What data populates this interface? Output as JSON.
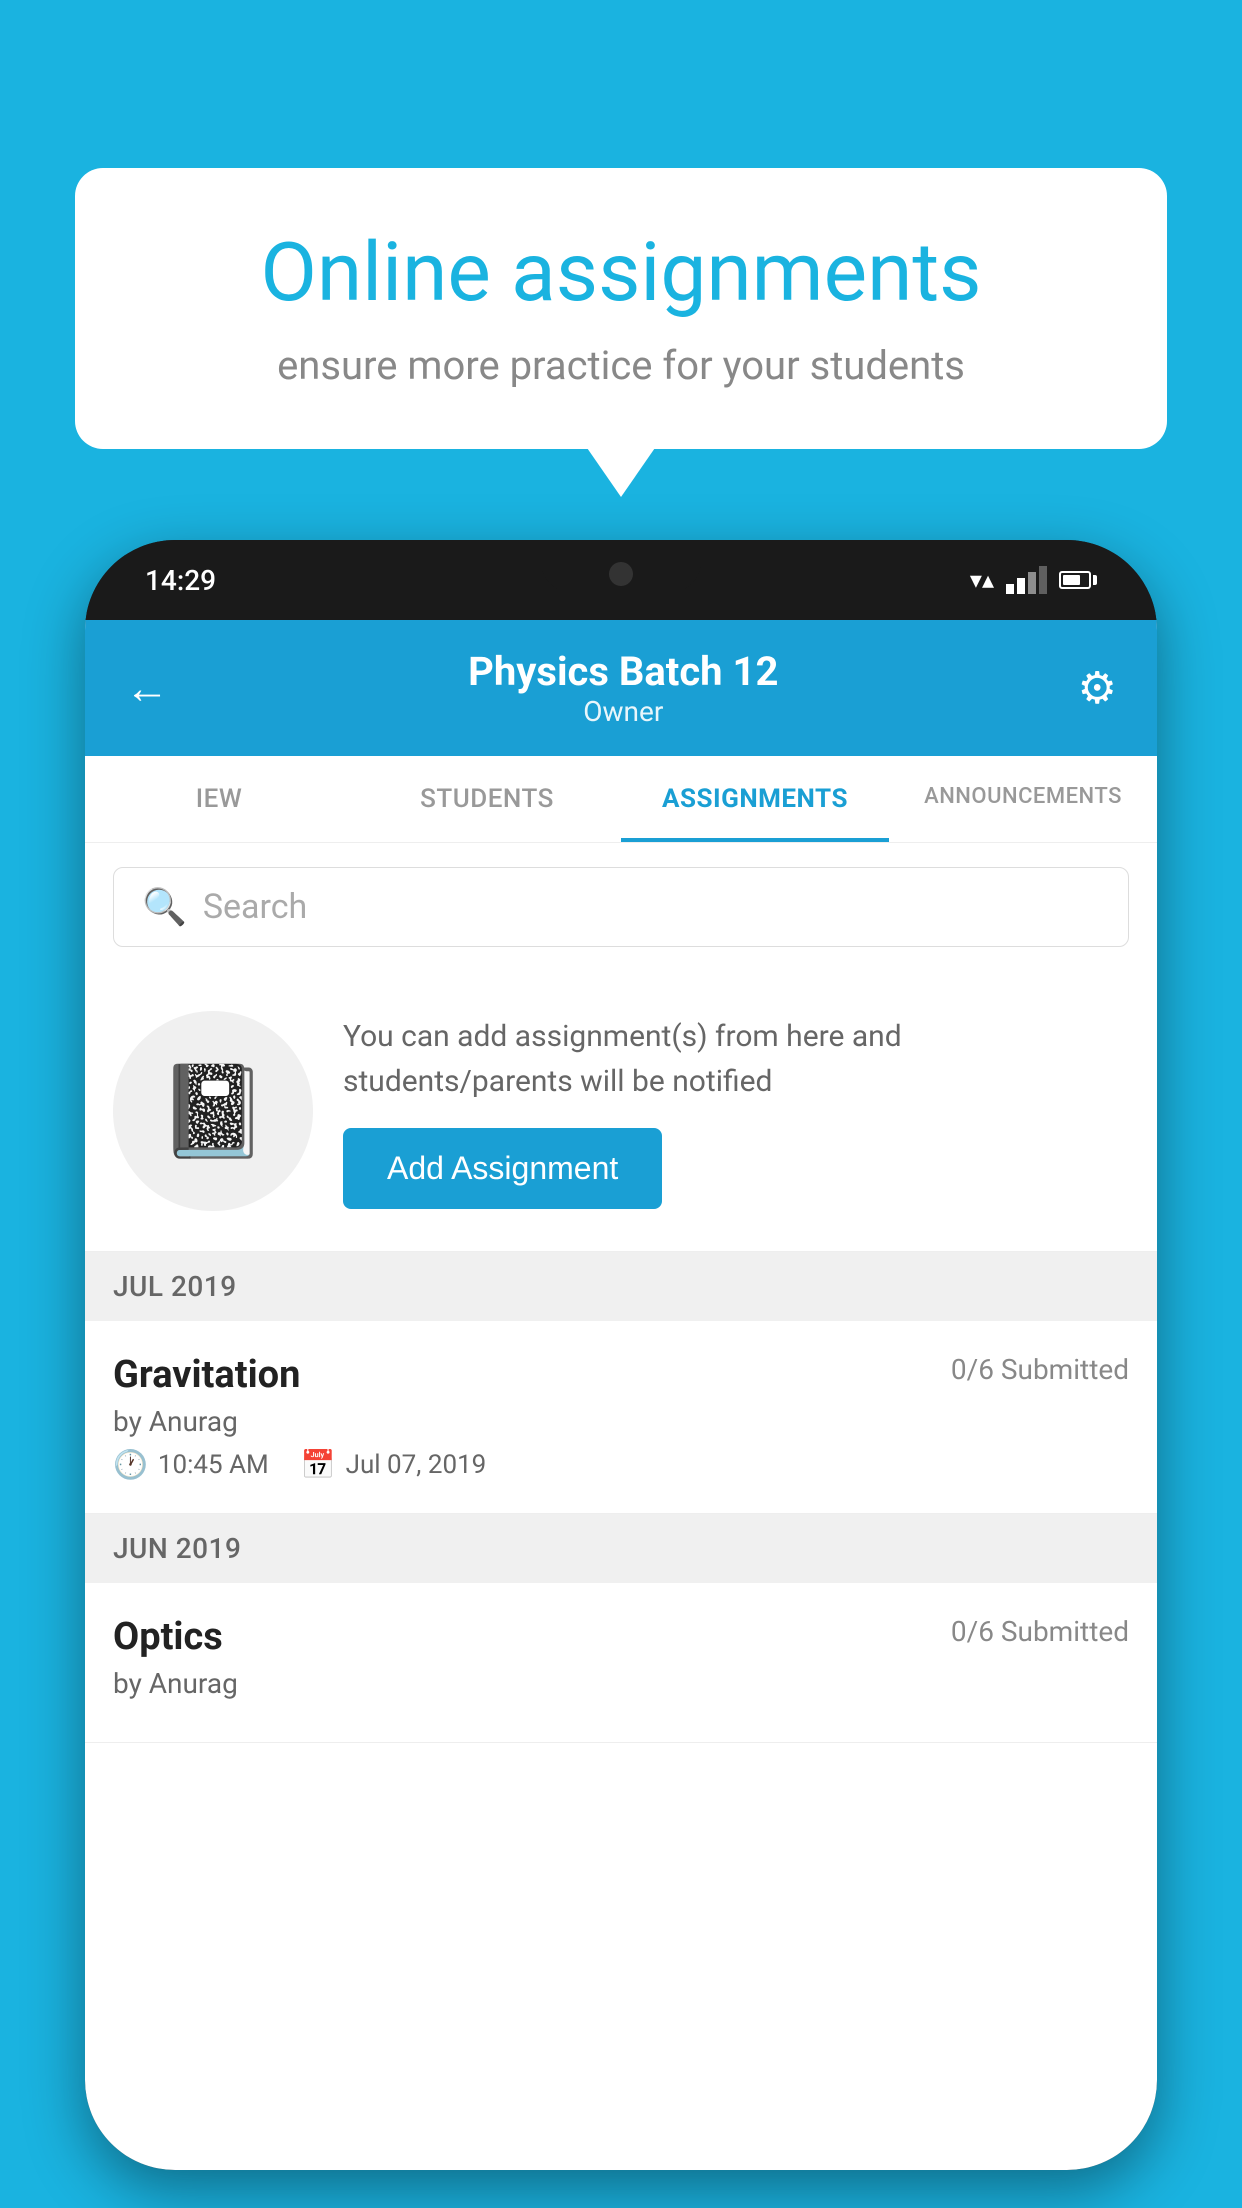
{
  "background_color": "#1ab3e0",
  "speech_bubble": {
    "title": "Online assignments",
    "subtitle": "ensure more practice for your students"
  },
  "phone": {
    "status_bar": {
      "time": "14:29",
      "wifi": "wifi",
      "signal": "signal",
      "battery": "battery"
    },
    "header": {
      "title": "Physics Batch 12",
      "subtitle": "Owner",
      "back_icon": "←",
      "settings_icon": "⚙"
    },
    "tabs": [
      {
        "label": "IEW",
        "active": false
      },
      {
        "label": "STUDENTS",
        "active": false
      },
      {
        "label": "ASSIGNMENTS",
        "active": true
      },
      {
        "label": "ANNOUNCEMENTS",
        "active": false
      }
    ],
    "search": {
      "placeholder": "Search"
    },
    "promo": {
      "description": "You can add assignment(s) from here and students/parents will be notified",
      "button_label": "Add Assignment"
    },
    "sections": [
      {
        "month": "JUL 2019",
        "assignments": [
          {
            "name": "Gravitation",
            "submitted": "0/6 Submitted",
            "author": "by Anurag",
            "time": "10:45 AM",
            "date": "Jul 07, 2019"
          }
        ]
      },
      {
        "month": "JUN 2019",
        "assignments": [
          {
            "name": "Optics",
            "submitted": "0/6 Submitted",
            "author": "by Anurag",
            "time": "",
            "date": ""
          }
        ]
      }
    ]
  }
}
